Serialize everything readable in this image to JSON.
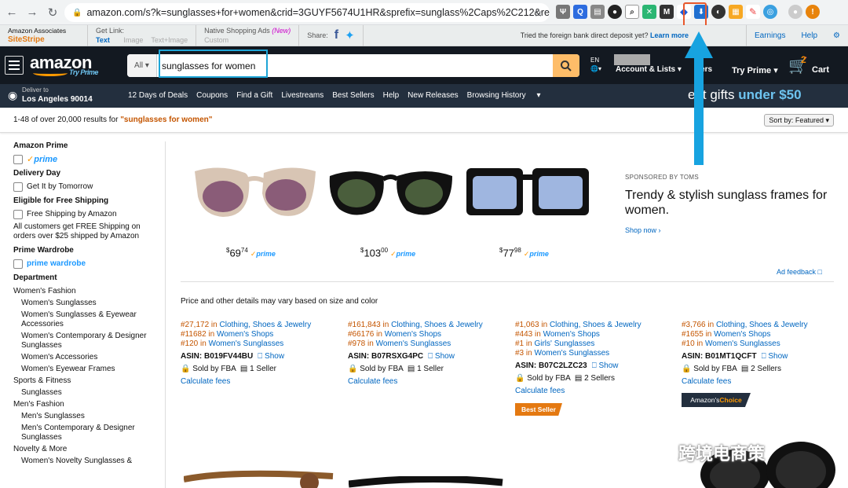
{
  "browser": {
    "url": "amazon.com/s?k=sunglasses+for+women&crid=3GUYF5674U1HR&sprefix=sunglass%2Caps%2C212&ref=nb_s...",
    "ext_badge": "!"
  },
  "sitestripe": {
    "brand_line1": "Amazon Associates",
    "brand_line2": "SiteStripe",
    "getlink_label": "Get Link:",
    "getlink_text": "Text",
    "getlink_image": "Image",
    "getlink_textimage": "Text+Image",
    "native_label": "Native Shopping Ads",
    "native_new": "(New)",
    "native_custom": "Custom",
    "share_label": "Share:",
    "promo_text": "Tried the foreign bank direct deposit yet?",
    "promo_link": "Learn more",
    "earnings": "Earnings",
    "help": "Help"
  },
  "header": {
    "logo": "amazon",
    "logo_sub": "Try Prime",
    "search_category": "All",
    "search_value": "sunglasses for women",
    "lang": "EN",
    "account": "Account & Lists",
    "orders": "ders",
    "try_prime": "Try Prime",
    "cart_count": "2",
    "cart_label": "Cart"
  },
  "subnav": {
    "deliver_line1": "Deliver to",
    "deliver_line2": "Los Angeles 90014",
    "links": [
      "12 Days of Deals",
      "Coupons",
      "Find a Gift",
      "Livestreams",
      "Best Sellers",
      "Help",
      "New Releases",
      "Browsing History"
    ],
    "promo_prefix": "eat gifts ",
    "promo_highlight": "under $50"
  },
  "results": {
    "count_text": "1-48 of over 20,000 results for ",
    "query": "\"sunglasses for women\"",
    "sort": "Sort by: Featured"
  },
  "sidebar": {
    "prime_heading": "Amazon Prime",
    "prime_label": "prime",
    "delivery_heading": "Delivery Day",
    "delivery_option": "Get It by Tomorrow",
    "shipping_heading": "Eligible for Free Shipping",
    "shipping_option": "Free Shipping by Amazon",
    "shipping_note": "All customers get FREE Shipping on orders over $25 shipped by Amazon",
    "wardrobe_heading": "Prime Wardrobe",
    "wardrobe_option": "prime wardrobe",
    "department_heading": "Department",
    "departments": [
      {
        "label": "Women's Fashion",
        "indent": false
      },
      {
        "label": "Women's Sunglasses",
        "indent": true
      },
      {
        "label": "Women's Sunglasses & Eyewear Accessories",
        "indent": true
      },
      {
        "label": "Women's Contemporary & Designer Sunglasses",
        "indent": true
      },
      {
        "label": "Women's Accessories",
        "indent": true
      },
      {
        "label": "Women's Eyewear Frames",
        "indent": true
      },
      {
        "label": "Sports & Fitness",
        "indent": false
      },
      {
        "label": "Sunglasses",
        "indent": true
      },
      {
        "label": "Men's Fashion",
        "indent": false
      },
      {
        "label": "Men's Sunglasses",
        "indent": true
      },
      {
        "label": "Men's Contemporary & Designer Sunglasses",
        "indent": true
      },
      {
        "label": "Novelty & More",
        "indent": false
      },
      {
        "label": "Women's Novelty Sunglasses &",
        "indent": true
      }
    ]
  },
  "sponsored": {
    "prices": [
      {
        "whole": "69",
        "frac": "74"
      },
      {
        "whole": "103",
        "frac": "00"
      },
      {
        "whole": "77",
        "frac": "98"
      }
    ],
    "prime_label": "prime",
    "sponsor_label": "SPONSORED BY TOMS",
    "title": "Trendy & stylish sunglass frames for women.",
    "shop_now": "Shop now ›",
    "ad_feedback": "Ad feedback"
  },
  "disclaimer": "Price and other details may vary based on size and color",
  "products": [
    {
      "ranks": [
        [
          "#27,172 in ",
          "Clothing, Shoes & Jewelry"
        ],
        [
          "#11682 in ",
          "Women's Shops"
        ],
        [
          "#120 in ",
          "Women's Sunglasses"
        ]
      ],
      "asin": "ASIN: B019FV44BU",
      "show": "Show",
      "fba": "Sold by FBA",
      "sellers": "1 Seller",
      "calc": "Calculate fees"
    },
    {
      "ranks": [
        [
          "#161,843 in ",
          "Clothing, Shoes & Jewelry"
        ],
        [
          "#66176 in ",
          "Women's Shops"
        ],
        [
          "#978 in ",
          "Women's Sunglasses"
        ]
      ],
      "asin": "ASIN: B07RSXG4PC",
      "show": "Show",
      "fba": "Sold by FBA",
      "sellers": "1 Seller",
      "calc": "Calculate fees"
    },
    {
      "ranks": [
        [
          "#1,063 in ",
          "Clothing, Shoes & Jewelry"
        ],
        [
          "#443 in ",
          "Women's Shops"
        ],
        [
          "#1 in ",
          "Girls' Sunglasses"
        ],
        [
          "#3 in ",
          "Women's Sunglasses"
        ]
      ],
      "asin": "ASIN: B07C2LZC23",
      "show": "Show",
      "fba": "Sold by FBA",
      "sellers": "2 Sellers",
      "calc": "Calculate fees",
      "badge": "Best Seller"
    },
    {
      "ranks": [
        [
          "#3,766 in ",
          "Clothing, Shoes & Jewelry"
        ],
        [
          "#1655 in ",
          "Women's Shops"
        ],
        [
          "#10 in ",
          "Women's Sunglasses"
        ]
      ],
      "asin": "ASIN: B01MT1QCFT",
      "show": "Show",
      "fba": "Sold by FBA",
      "sellers": "2 Sellers",
      "calc": "Calculate fees"
    }
  ],
  "choice_badge": {
    "prefix": "Amazon's ",
    "highlight": "Choice"
  },
  "watermark": "跨境电商策"
}
